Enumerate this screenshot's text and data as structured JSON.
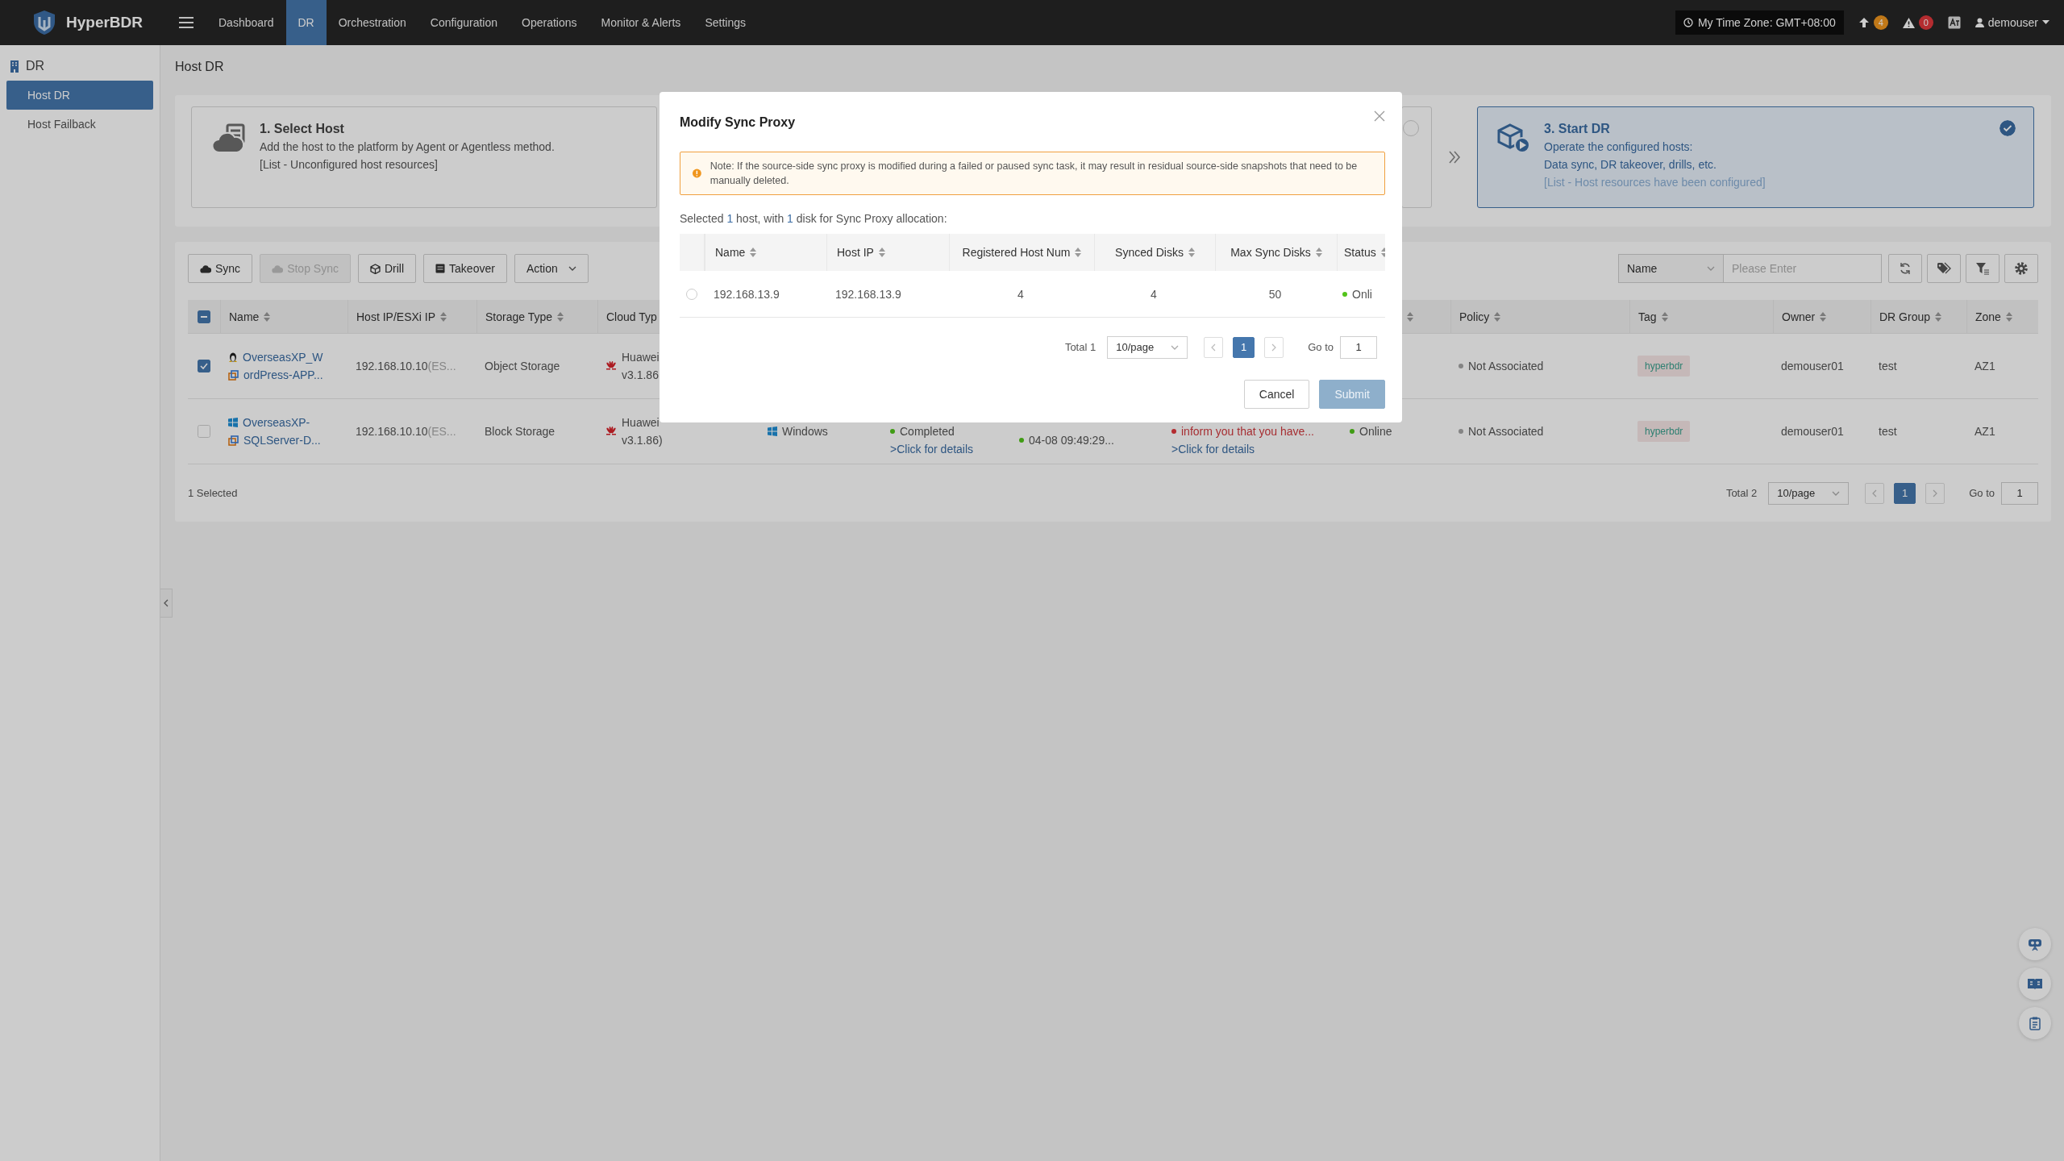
{
  "topbar": {
    "brand": "HyperBDR",
    "nav": [
      {
        "label": "Dashboard",
        "selected": false
      },
      {
        "label": "DR",
        "selected": true
      },
      {
        "label": "Orchestration",
        "selected": false
      },
      {
        "label": "Configuration",
        "selected": false
      },
      {
        "label": "Operations",
        "selected": false
      },
      {
        "label": "Monitor & Alerts",
        "selected": false
      },
      {
        "label": "Settings",
        "selected": false
      }
    ],
    "timezone": "My Time Zone: GMT+08:00",
    "notifications": [
      {
        "kind": "upload",
        "count": "4",
        "color": "#c07818"
      },
      {
        "kind": "alert",
        "count": "0",
        "color": "#b42c30"
      }
    ],
    "user": "demouser"
  },
  "sidebar": {
    "section": "DR",
    "items": [
      {
        "label": "Host DR",
        "selected": true
      },
      {
        "label": "Host Failback",
        "selected": false
      }
    ]
  },
  "page_title": "Host DR",
  "steps": [
    {
      "kind": "host",
      "title": "1. Select Host",
      "lines": [
        "Add the host to the platform by Agent or Agentless method.",
        "[List - Unconfigured host resources]"
      ],
      "selected": false
    },
    {
      "selected": false
    },
    {
      "kind": "dr",
      "title": "3. Start DR",
      "lines": [
        "Operate the configured hosts:",
        "Data sync, DR takeover, drills, etc.",
        "[List - Host resources have been configured]"
      ],
      "selected": true
    }
  ],
  "toolbar": {
    "buttons": [
      {
        "kind": "sync",
        "label": "Sync",
        "disabled": false
      },
      {
        "kind": "stop",
        "label": "Stop Sync",
        "disabled": true
      },
      {
        "kind": "drill",
        "label": "Drill",
        "disabled": false
      },
      {
        "kind": "takeover",
        "label": "Takeover",
        "disabled": false
      },
      {
        "kind": "menu",
        "label": "Action",
        "disabled": false
      }
    ],
    "search": {
      "field": "Name",
      "placeholder": "Please Enter"
    }
  },
  "table": {
    "select_all": {
      "indeterminate": true
    },
    "columns": [
      {
        "label": "Name",
        "sortable": true
      },
      {
        "label": "Host IP/ESXi IP",
        "sortable": true
      },
      {
        "label": "Storage Type",
        "sortable": true
      },
      {
        "label": "Cloud Typ"
      },
      {},
      {},
      {},
      {},
      {
        "sortable": true
      },
      {
        "label": "Policy",
        "sortable": true
      },
      {
        "label": "Tag",
        "sortable": true
      },
      {
        "label": "Owner",
        "sortable": true
      },
      {
        "label": "DR Group",
        "sortable": true
      },
      {
        "label": "Zone",
        "sortable": true
      }
    ],
    "rows": [
      {
        "checked": true,
        "cells": [
          {
            "lines": [
              {
                "text": "OverseasXP_W",
                "kind": "linux"
              },
              {
                "text": "ordPress-APP...",
                "kind": "vm"
              }
            ]
          },
          {
            "lines": [
              {
                "text": "192.168.10.10",
                "suffix": "(ES..."
              }
            ]
          },
          {
            "lines": [
              {
                "text": "Object Storage"
              }
            ]
          },
          {
            "kind": "huawei",
            "lines": [
              {
                "text": "Huawei"
              },
              {
                "text": "v3.1.86"
              }
            ]
          },
          {},
          {},
          {},
          {},
          {},
          {
            "lines": [
              {
                "text": "Not Associated",
                "color": "#848484"
              }
            ]
          },
          {
            "lines": [
              {
                "text": "hyperbdr",
                "kind": "chip"
              }
            ]
          },
          {
            "lines": [
              {
                "text": "demouser01"
              }
            ]
          },
          {
            "lines": [
              {
                "text": "test"
              }
            ]
          },
          {
            "lines": [
              {
                "text": "AZ1"
              }
            ]
          }
        ]
      },
      {
        "checked": false,
        "cells": [
          {
            "lines": [
              {
                "text": "OverseasXP-",
                "kind": "windows"
              },
              {
                "text": "SQLServer-D...",
                "kind": "vm"
              }
            ]
          },
          {
            "lines": [
              {
                "text": "192.168.10.10",
                "suffix": "(ES..."
              }
            ]
          },
          {
            "lines": [
              {
                "text": "Block Storage"
              }
            ]
          },
          {
            "kind": "huawei",
            "lines": [
              {
                "text": "Huawei"
              },
              {
                "text": "v3.1.86)"
              }
            ]
          },
          {
            "lines": [
              {
                "text": "Windows",
                "kind": "windows"
              }
            ]
          },
          {
            "lines": [
              {
                "text": "Completed",
                "color": "#409c14"
              },
              {
                "text": ">Click for details",
                "kind": "link"
              }
            ]
          },
          {
            "lines": [
              {
                "text": "04-08 09:49:29...",
                "color": "#409c14"
              }
            ]
          },
          {
            "lines": [
              {
                "text": "inform you that you have...",
                "color": "#b42c30",
                "kind": "error"
              },
              {
                "text": ">Click for details",
                "kind": "link"
              }
            ]
          },
          {
            "lines": [
              {
                "text": "Online",
                "color": "#409c14"
              }
            ]
          },
          {
            "lines": [
              {
                "text": "Not Associated",
                "color": "#848484"
              }
            ]
          },
          {
            "lines": [
              {
                "text": "hyperbdr",
                "kind": "chip"
              }
            ]
          },
          {
            "lines": [
              {
                "text": "demouser01"
              }
            ]
          },
          {
            "lines": [
              {
                "text": "test"
              }
            ]
          },
          {
            "lines": [
              {
                "text": "AZ1"
              }
            ]
          }
        ]
      }
    ],
    "selected_count": "1 Selected",
    "pagination": {
      "total": "Total 2",
      "page_size": "10/page",
      "pages": [
        {
          "label": "1",
          "selected": true
        }
      ],
      "goto_label": "Go to",
      "goto_value": "1"
    }
  },
  "modal": {
    "title": "Modify Sync Proxy",
    "warning": "Note: If the source-side sync proxy is modified during a failed or paused sync task, it may result in residual source-side snapshots that need to be manually deleted.",
    "summary": [
      {
        "text": "Selected ",
        "highlight": false
      },
      {
        "text": "1",
        "highlight": true
      },
      {
        "text": " host, with ",
        "highlight": false
      },
      {
        "text": "1",
        "highlight": true
      },
      {
        "text": " disk for Sync Proxy allocation:",
        "highlight": false
      }
    ],
    "columns": [
      {
        "label": "Name",
        "sortable": true
      },
      {
        "label": "Host IP",
        "sortable": true
      },
      {
        "label": "Registered Host Num",
        "sortable": true
      },
      {
        "label": "Synced Disks",
        "sortable": true
      },
      {
        "label": "Max Sync Disks",
        "sortable": true
      },
      {
        "label": "Status",
        "sortable": true
      }
    ],
    "rows": [
      {
        "selected": false,
        "cells": [
          "192.168.13.9",
          "192.168.13.9",
          "4",
          "4",
          "50"
        ],
        "status": {
          "text": "Onli",
          "color": "#52c41a"
        }
      }
    ],
    "pagination": {
      "total": "Total 1",
      "page_size": "10/page",
      "pages": [
        {
          "label": "1",
          "selected": true
        }
      ],
      "goto_label": "Go to",
      "goto_value": "1"
    },
    "buttons": [
      {
        "kind": "default",
        "label": "Cancel",
        "disabled": false
      },
      {
        "kind": "primary",
        "label": "Submit",
        "disabled": true
      }
    ]
  }
}
